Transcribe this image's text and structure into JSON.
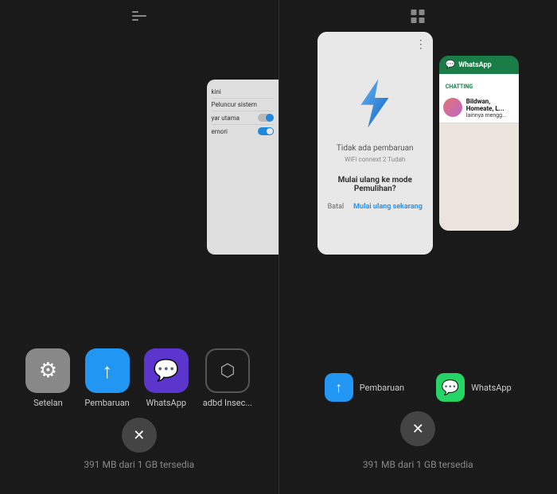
{
  "left": {
    "top_icon": "|||",
    "apps": [
      {
        "id": "setelan",
        "label": "Setelan",
        "icon": "⚙",
        "bg": "gray"
      },
      {
        "id": "pembaruan",
        "label": "Pembaruan",
        "icon": "↑",
        "bg": "blue"
      },
      {
        "id": "whatsapp",
        "label": "WhatsApp",
        "icon": "●",
        "bg": "purple"
      },
      {
        "id": "adbd",
        "label": "adbd Insec...",
        "icon": "⬡",
        "bg": "dark"
      }
    ],
    "memory_text": "391 MB dari 1 GB tersedia"
  },
  "right": {
    "top_icon": "grid",
    "cards": {
      "settings": {
        "rows": [
          "kini",
          "Peluncur sistem",
          "yar utama",
          "emori"
        ]
      },
      "pembaruan": {
        "no_update": "Tidak ada pembaruan",
        "sub": "WiFi connext 2 Tudah",
        "question": "Mulai ulang ke mode Pemulihan?",
        "btn_cancel": "Batal",
        "btn_confirm": "Mulai ulang sekarang"
      },
      "whatsapp": {
        "title": "WhatsApp",
        "badge": "CHATTING",
        "chat_name": "Bildwan, Homeate, L...",
        "chat_text": "lainnya mengg..."
      }
    },
    "bottom_apps": [
      {
        "id": "pembaruan",
        "label": "Pembaruan",
        "icon": "↑",
        "bg": "blue"
      },
      {
        "id": "whatsapp",
        "label": "WhatsApp",
        "icon": "W",
        "bg": "green"
      }
    ],
    "memory_text": "391 MB dari 1 GB tersedia"
  }
}
